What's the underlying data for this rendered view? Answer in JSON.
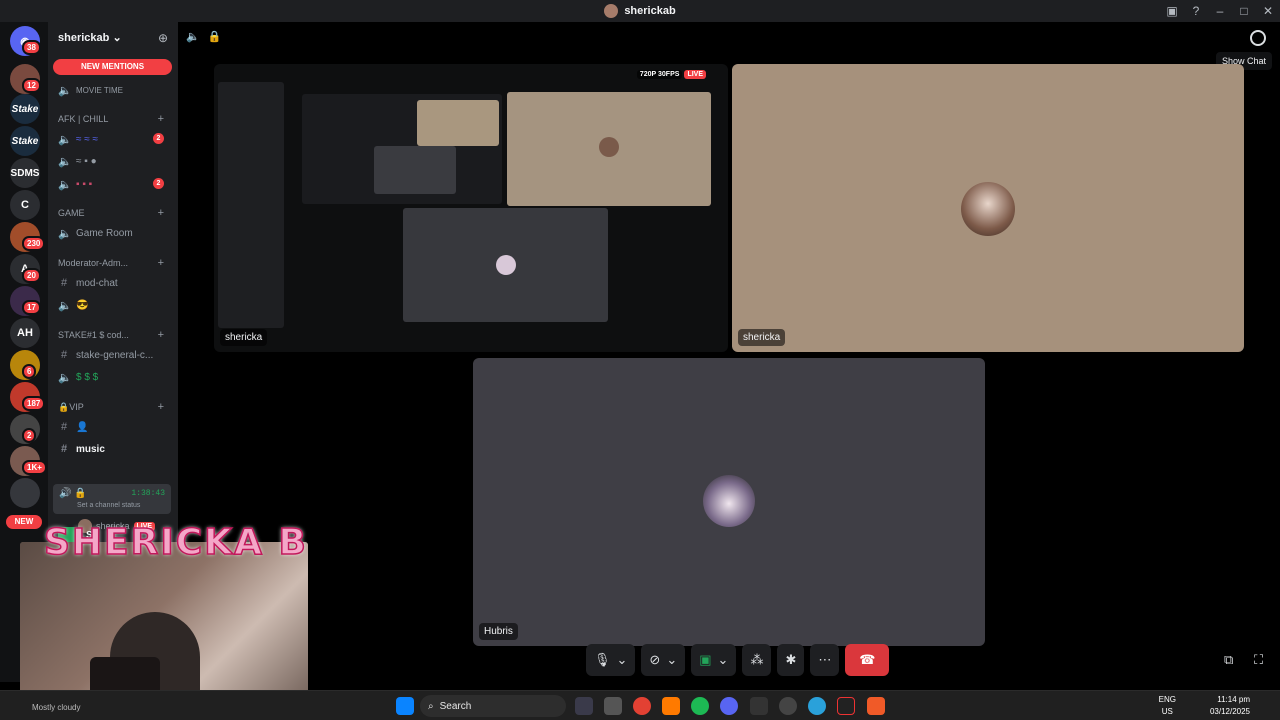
{
  "window": {
    "title": "sherickab"
  },
  "tooltip": {
    "show_chat": "Show Chat"
  },
  "colors": {
    "accent": "#5865f2",
    "danger": "#f23f43",
    "online": "#23a55a",
    "bg": "#1e1f22"
  },
  "guild_badges": [
    "38",
    "12",
    "230",
    "20",
    "17",
    "6",
    "187",
    "2",
    "1K+"
  ],
  "guild_labels": {
    "sdms": "SDMS",
    "c": "C",
    "ah": "AH",
    "stake1": "Stake",
    "stake2": "Stake"
  },
  "new_pill": "NEW",
  "sidebar": {
    "server_name": "sherickab",
    "new_mentions": "NEW MENTIONS",
    "movie_time": "MOVIE TIME",
    "cat_afk": "AFK | CHILL",
    "badge_two_a": "2",
    "badge_two_b": "2",
    "cat_game": "GAME",
    "game_room": "Game Room",
    "cat_mod": "Moderator-Adm...",
    "mod_chat": "mod-chat",
    "cat_stake": "STAKE#1 $ cod...",
    "stake_general": "stake-general-c...",
    "cat_vip": "VIP",
    "music": "music",
    "timer": "1:38:43",
    "status": "Set a channel status",
    "vc_user": "shericka",
    "live": "LIVE",
    "server_prefix": "S"
  },
  "tiles": [
    {
      "name": "shericka",
      "quality": "720P 30FPS",
      "live": "LIVE"
    },
    {
      "name": "shericka"
    },
    {
      "name": "Hubris"
    }
  ],
  "overlay": {
    "title": "SHERICKA B"
  },
  "taskbar": {
    "search": "Search",
    "lang1": "ENG",
    "lang2": "US",
    "time": "11:14 pm",
    "date": "03/12/2025",
    "weather": "Mostly cloudy"
  }
}
